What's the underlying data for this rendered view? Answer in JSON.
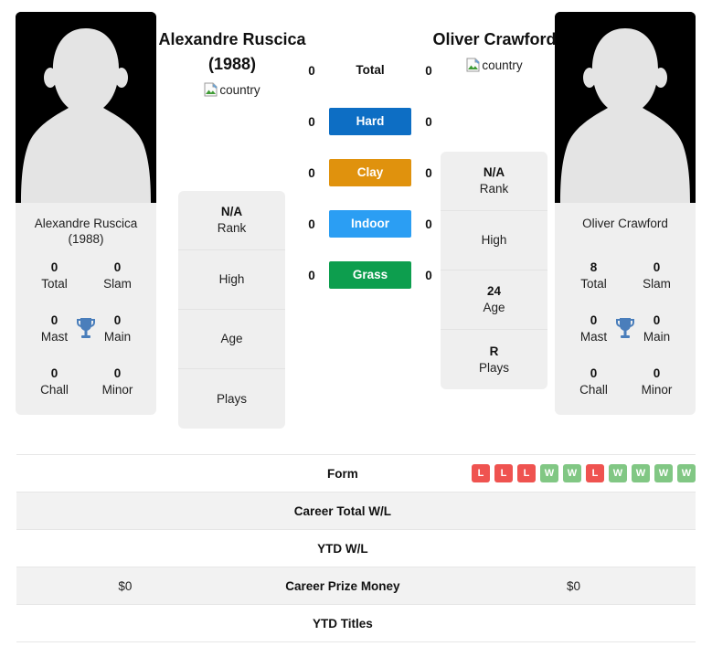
{
  "players": {
    "left": {
      "headline_name": "Alexandre Ruscica (1988)",
      "flag_alt": "country",
      "card_name": "Alexandre Ruscica (1988)",
      "titles": [
        {
          "value": "0",
          "label": "Total"
        },
        {
          "value": "0",
          "label": "Slam"
        },
        {
          "value": "0",
          "label": "Mast"
        },
        {
          "value": "0",
          "label": "Main"
        },
        {
          "value": "0",
          "label": "Chall"
        },
        {
          "value": "0",
          "label": "Minor"
        }
      ],
      "info": [
        {
          "value": "N/A",
          "label": "Rank"
        },
        {
          "value": "",
          "label": "High"
        },
        {
          "value": "",
          "label": "Age"
        },
        {
          "value": "",
          "label": "Plays"
        }
      ],
      "prize_money": "$0"
    },
    "right": {
      "headline_name": "Oliver Crawford",
      "flag_alt": "country",
      "card_name": "Oliver Crawford",
      "titles": [
        {
          "value": "8",
          "label": "Total"
        },
        {
          "value": "0",
          "label": "Slam"
        },
        {
          "value": "0",
          "label": "Mast"
        },
        {
          "value": "0",
          "label": "Main"
        },
        {
          "value": "0",
          "label": "Chall"
        },
        {
          "value": "0",
          "label": "Minor"
        }
      ],
      "info": [
        {
          "value": "N/A",
          "label": "Rank"
        },
        {
          "value": "",
          "label": "High"
        },
        {
          "value": "24",
          "label": "Age"
        },
        {
          "value": "R",
          "label": "Plays"
        }
      ],
      "prize_money": "$0"
    }
  },
  "surfaces": [
    {
      "label": "Total",
      "left_value": "0",
      "right_value": "0",
      "color": ""
    },
    {
      "label": "Hard",
      "left_value": "0",
      "right_value": "0",
      "color": "#0d6ec4"
    },
    {
      "label": "Clay",
      "left_value": "0",
      "right_value": "0",
      "color": "#e0920d"
    },
    {
      "label": "Indoor",
      "left_value": "0",
      "right_value": "0",
      "color": "#2b9ef3"
    },
    {
      "label": "Grass",
      "left_value": "0",
      "right_value": "0",
      "color": "#0d9e4e"
    }
  ],
  "table": {
    "form": {
      "label": "Form",
      "results": [
        "L",
        "L",
        "L",
        "W",
        "W",
        "L",
        "W",
        "W",
        "W",
        "W"
      ]
    },
    "rows": [
      {
        "label": "Career Total W/L",
        "left": "",
        "right": ""
      },
      {
        "label": "YTD W/L",
        "left": "",
        "right": ""
      },
      {
        "label": "Career Prize Money",
        "left": "$0",
        "right": "$0"
      },
      {
        "label": "YTD Titles",
        "left": "",
        "right": ""
      }
    ]
  },
  "colors": {
    "win": "#81c784",
    "loss": "#ef5350",
    "trophy": "#4a7ebb",
    "card_bg": "#efefef",
    "stripe_bg": "#f2f2f2"
  }
}
